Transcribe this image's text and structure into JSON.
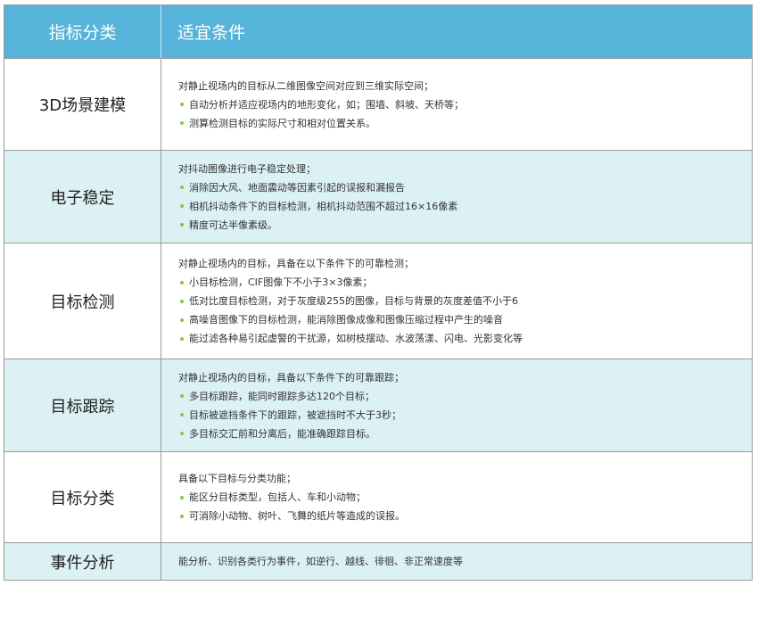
{
  "header": {
    "col1": "指标分类",
    "col2": "适宜条件"
  },
  "rows": [
    {
      "name": "3D场景建模",
      "intro": "对静止视场内的目标从二维图像空间对应到三维实际空间；",
      "bullets": [
        "自动分析并适应视场内的地形变化，如；围墙、斜坡、天桥等；",
        "测算检测目标的实际尺寸和相对位置关系。"
      ]
    },
    {
      "name": "电子稳定",
      "intro": "对抖动图像进行电子稳定处理；",
      "bullets": [
        "消除因大风、地面震动等因素引起的误报和漏报告",
        "相机抖动条件下的目标检测，相机抖动范围不超过16×16像素",
        "精度可达半像素级。"
      ]
    },
    {
      "name": "目标检测",
      "intro": "对静止视场内的目标，具备在以下条件下的可靠检测；",
      "bullets": [
        "小目标检测，CIF图像下不小于3×3像素；",
        "低对比度目标检测，对于灰度级255的图像，目标与背景的灰度差值不小于6",
        "高噪音图像下的目标检测，能消除图像成像和图像压缩过程中产生的噪音",
        "能过滤各种易引起虚警的干扰源，如树枝摆动、水波荡漾、闪电、光影变化等"
      ]
    },
    {
      "name": "目标跟踪",
      "intro": "对静止视场内的目标，具备以下条件下的可靠跟踪；",
      "bullets": [
        "多目标跟踪，能同时跟踪多达120个目标；",
        "目标被遮挡条件下的跟踪，被遮挡时不大于3秒；",
        "多目标交汇前和分离后，能准确跟踪目标。"
      ]
    },
    {
      "name": "目标分类",
      "intro": "具备以下目标与分类功能；",
      "bullets": [
        "能区分目标类型，包括人、车和小动物；",
        "可消除小动物、树叶、飞舞的纸片等造成的误报。"
      ]
    },
    {
      "name": "事件分析",
      "intro": "能分析、识别各类行为事件，如逆行、越线、徘徊、非正常速度等",
      "bullets": []
    }
  ],
  "colors": {
    "header_bg": "#56b3d9",
    "tint_row_bg": "#dcf1f4",
    "bullet": "#7ccf3b",
    "border": "#9a9a9a"
  }
}
